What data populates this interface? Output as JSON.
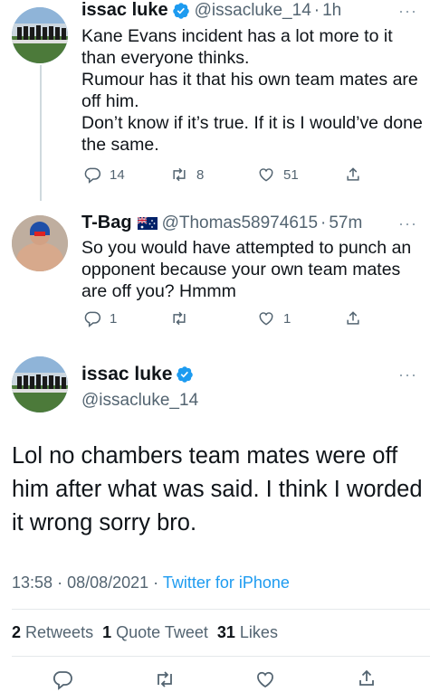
{
  "tweet1": {
    "name": "issac luke",
    "handle": "@issacluke_14",
    "time": "1h",
    "text_lines": [
      "Kane Evans incident has a lot more to it than everyone thinks.",
      "Rumour has it that his own team mates are off him.",
      "Don’t know if it’s true. If it is I would’ve done the same."
    ],
    "replies": "14",
    "retweets": "8",
    "likes": "51",
    "more_label": "···"
  },
  "tweet2": {
    "name": "T-Bag",
    "handle": "@Thomas58974615",
    "time": "57m",
    "text": "So you would have attempted to punch an opponent because your own team mates are off you? Hmmm",
    "replies": "1",
    "likes": "1",
    "more_label": "···"
  },
  "main": {
    "name": "issac luke",
    "handle": "@issacluke_14",
    "text": "Lol no chambers team mates were off him after what was said. I think I worded it wrong sorry bro.",
    "time": "13:58",
    "date": "08/08/2021",
    "source": "Twitter for iPhone",
    "retweets_count": "2",
    "retweets_label": "Retweets",
    "quotes_count": "1",
    "quotes_label": "Quote Tweet",
    "likes_count": "31",
    "likes_label": "Likes",
    "more_label": "···"
  },
  "colors": {
    "link": "#1d9bf0",
    "muted": "#536471",
    "verified": "#1d9bf0"
  },
  "icons": [
    "reply-icon",
    "retweet-icon",
    "like-icon",
    "share-icon",
    "verified-icon",
    "australia-flag-icon"
  ]
}
